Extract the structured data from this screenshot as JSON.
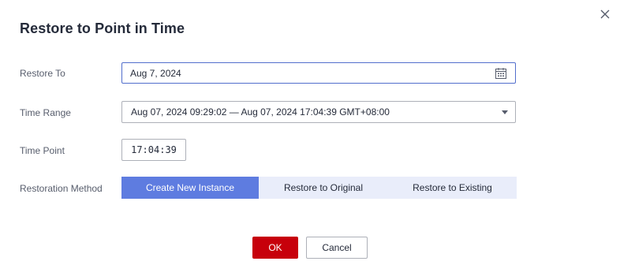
{
  "dialog": {
    "title": "Restore to Point in Time"
  },
  "form": {
    "restore_to": {
      "label": "Restore To",
      "value": "Aug 7, 2024"
    },
    "time_range": {
      "label": "Time Range",
      "value": "Aug 07, 2024 09:29:02 — Aug 07, 2024 17:04:39 GMT+08:00"
    },
    "time_point": {
      "label": "Time Point",
      "value": "17:04:39"
    },
    "restoration_method": {
      "label": "Restoration Method",
      "options": [
        "Create New Instance",
        "Restore to Original",
        "Restore to Existing"
      ],
      "selected": "Create New Instance"
    }
  },
  "footer": {
    "ok_label": "OK",
    "cancel_label": "Cancel"
  },
  "colors": {
    "primary_button": "#c7000b",
    "segment_active": "#5e7ce0",
    "segment_inactive": "#e9edfa",
    "focused_border": "#526ecc"
  },
  "icons": {
    "close": "close-icon",
    "calendar": "calendar-icon",
    "dropdown": "chevron-down-icon"
  }
}
